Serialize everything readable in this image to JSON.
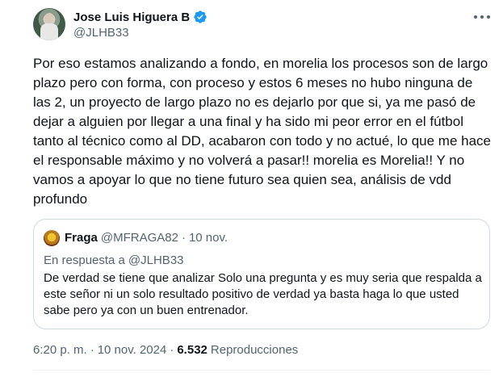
{
  "author": {
    "display_name": "Jose Luis Higuera B",
    "handle": "@JLHB33",
    "verified": true
  },
  "icons": {
    "verified": "verified-badge-icon",
    "more": "more-options-icon"
  },
  "colors": {
    "verified_blue": "#1d9bf0",
    "text_primary": "#0f1419",
    "text_secondary": "#536471",
    "border": "#cfd9de"
  },
  "tweet": {
    "text": "Por eso estamos analizando a fondo, en morelia los procesos son de largo plazo pero con forma, con proceso y estos 6 meses no hubo ninguna de las 2, un proyecto de largo plazo no es dejarlo por que si, ya me pasó de dejar a alguien por llegar a una final y ha sido mi peor error en el fútbol tanto al técnico como al DD, acabaron con todo y no actué, lo que me hace el responsable máximo y no volverá a pasar!! morelia es Morelia!! Y no vamos a apoyar lo que no tiene futuro sea quien sea, análisis de vdd profundo"
  },
  "quote": {
    "display_name": "Fraga",
    "handle": "@MFRAGA82",
    "separator": "·",
    "date": "10 nov.",
    "reply_label": "En respuesta a",
    "reply_handle": "@JLHB33",
    "text": "De verdad se tiene que analizar Solo una pregunta y es muy seria que respalda a este señor ni un solo resultado positivo de verdad ya basta haga lo que usted sabe pero ya con un buen entrenador."
  },
  "meta": {
    "time": "6:20 p. m.",
    "separator": "·",
    "date": "10 nov. 2024",
    "views_count": "6.532",
    "views_label": "Reproducciones"
  }
}
